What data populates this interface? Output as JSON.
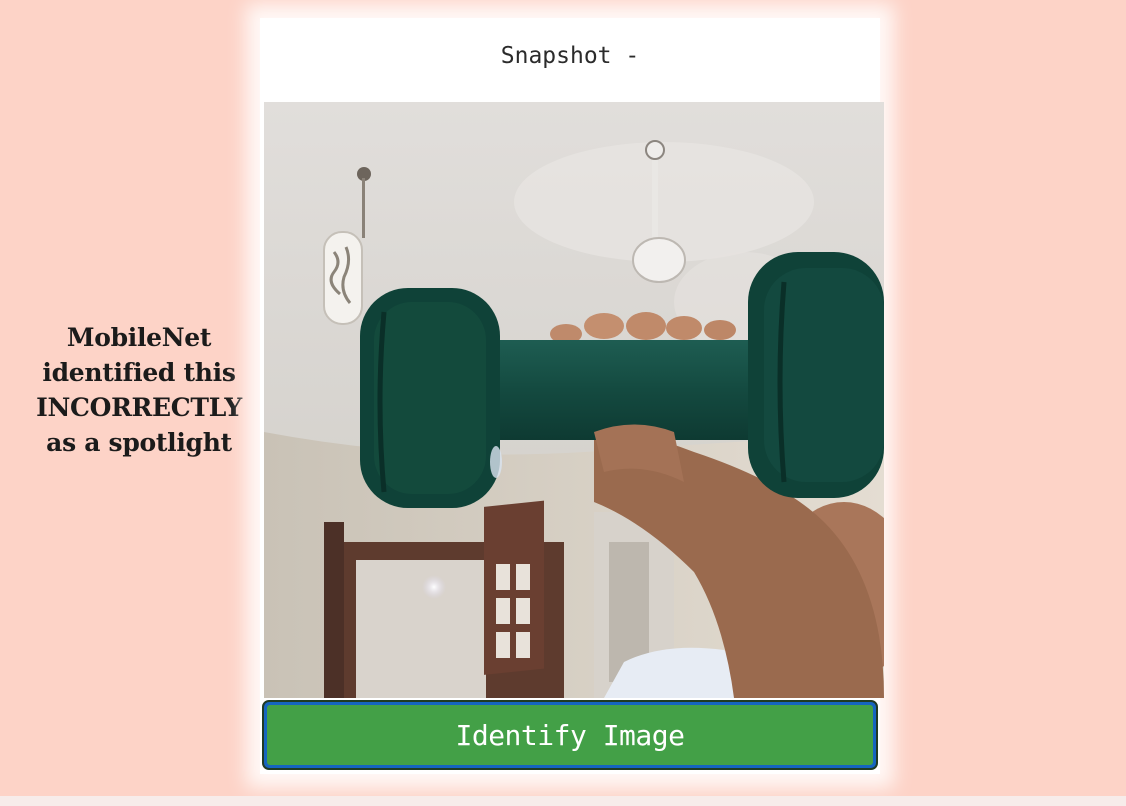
{
  "result": {
    "lines": [
      "MobileNet",
      "identified this",
      "INCORRECTLY",
      "as a spotlight"
    ]
  },
  "card": {
    "title": "Snapshot -",
    "identify_button_label": "Identify Image"
  },
  "colors": {
    "page_background": "#fdd3c7",
    "button_green": "#43a047",
    "button_border_blue": "#1565c0"
  }
}
